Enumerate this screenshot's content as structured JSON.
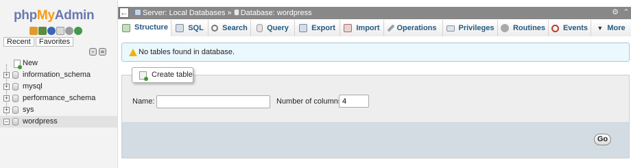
{
  "nav": {
    "logo": {
      "php": "php",
      "my": "My",
      "admin": "Admin"
    },
    "icons": [
      "home-icon",
      "database-icon",
      "info-icon",
      "docs-icon",
      "settings-icon",
      "reload-icon"
    ],
    "tabs": {
      "recent": "Recent",
      "favorites": "Favorites"
    },
    "tree": {
      "new": "New",
      "databases": [
        "information_schema",
        "mysql",
        "performance_schema",
        "sys",
        "wordpress"
      ],
      "selected": "wordpress"
    }
  },
  "topbar": {
    "server": "Server: Local Databases",
    "separator": "»",
    "database": "Database: wordpress"
  },
  "tabs": [
    {
      "label": "Structure",
      "icon": "structure-icon"
    },
    {
      "label": "SQL",
      "icon": "sql-icon"
    },
    {
      "label": "Search",
      "icon": "search-icon"
    },
    {
      "label": "Query",
      "icon": "query-icon"
    },
    {
      "label": "Export",
      "icon": "export-icon"
    },
    {
      "label": "Import",
      "icon": "import-icon"
    },
    {
      "label": "Operations",
      "icon": "operations-icon"
    },
    {
      "label": "Privileges",
      "icon": "privileges-icon"
    },
    {
      "label": "Routines",
      "icon": "routines-icon"
    },
    {
      "label": "Events",
      "icon": "events-icon"
    },
    {
      "label": "More",
      "icon": "more-icon"
    }
  ],
  "notice": {
    "text": "No tables found in database."
  },
  "create_table": {
    "legend": "Create table",
    "name_label": "Name:",
    "name_value": "",
    "columns_label": "Number of columns:",
    "columns_value": "4",
    "go_label": "Go"
  },
  "colors": {
    "tab_text": "#235a81",
    "notice_bg": "#ebf8fd",
    "footer_bg": "#d3dce3",
    "logo_blue": "#6c78af",
    "logo_orange": "#f89c0e"
  }
}
